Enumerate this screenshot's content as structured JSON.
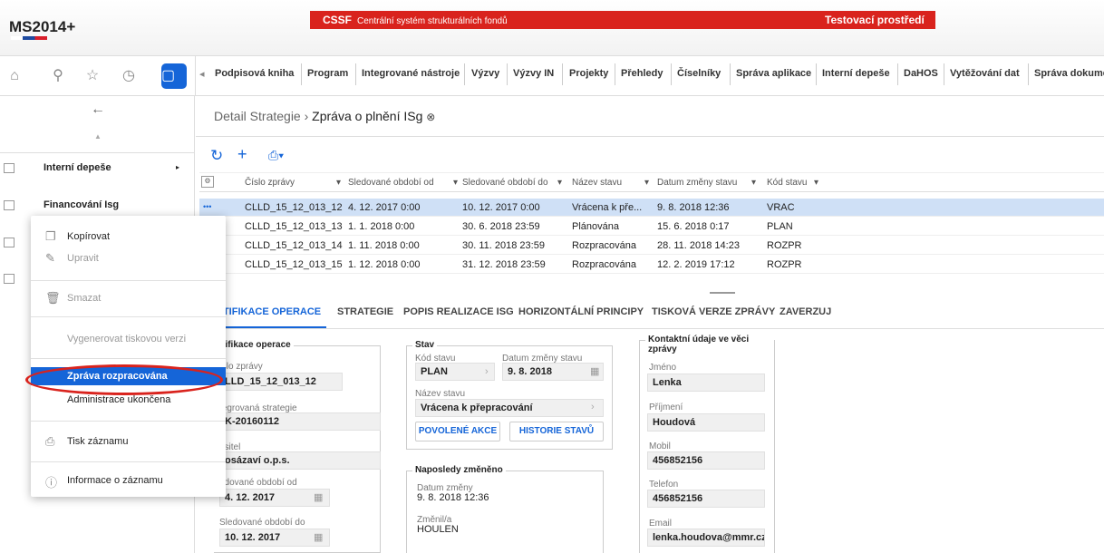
{
  "app": {
    "logo": "MS2014+"
  },
  "banner": {
    "title": "CSSF",
    "subtitle": "Centrální systém strukturálních fondů",
    "env": "Testovací prostředí"
  },
  "menu": [
    "Podpisová kniha",
    "Program",
    "Integrované nástroje",
    "Výzvy",
    "Výzvy IN",
    "Projekty",
    "Přehledy",
    "Číselníky",
    "Správa aplikace",
    "Interní depeše",
    "DaHOS",
    "Vytěžování dat",
    "Správa dokume"
  ],
  "sidebar": {
    "items": [
      {
        "label": "Interní depeše"
      },
      {
        "label": "Financování Isg"
      }
    ]
  },
  "breadcrumb": {
    "parent": "Detail Strategie",
    "current": "Zpráva o plnění ISg"
  },
  "grid": {
    "headers": [
      "Číslo zprávy",
      "Sledované období od",
      "Sledované období do",
      "Název stavu",
      "Datum změny stavu",
      "Kód stavu"
    ],
    "rows": [
      [
        "CLLD_15_12_013_12",
        "4. 12. 2017 0:00",
        "10. 12. 2017 0:00",
        "Vrácena k pře...",
        "9. 8. 2018 12:36",
        "VRAC"
      ],
      [
        "CLLD_15_12_013_13",
        "1. 1. 2018 0:00",
        "30. 6. 2018 23:59",
        "Plánována",
        "15. 6. 2018 0:17",
        "PLAN"
      ],
      [
        "CLLD_15_12_013_14",
        "1. 11. 2018 0:00",
        "30. 11. 2018 23:59",
        "Rozpracována",
        "28. 11. 2018 14:23",
        "ROZPR"
      ],
      [
        "CLLD_15_12_013_15",
        "1. 12. 2018 0:00",
        "31. 12. 2018 23:59",
        "Rozpracována",
        "12. 2. 2019 17:12",
        "ROZPR"
      ]
    ]
  },
  "tabs": [
    "NTIFIKACE OPERACE",
    "STRATEGIE",
    "POPIS REALIZACE ISG",
    "HORIZONTÁLNÍ PRINCIPY",
    "TISKOVÁ VERZE ZPRÁVY",
    "ZAVERZUJ"
  ],
  "ident": {
    "legend": "ntifikace operace",
    "cislo_lbl": "íslo zprávy",
    "cislo": "LLD_15_12_013_12",
    "strat_lbl": "tegrovaná strategie",
    "strat": "K-20160112",
    "nos_lbl": "ositel",
    "nos": "osázaví o.p.s.",
    "od_lbl": "edované období od",
    "od": "4. 12. 2017",
    "do_lbl": "Sledované období do",
    "do": "10. 12. 2017"
  },
  "stav": {
    "legend": "Stav",
    "kod_lbl": "Kód stavu",
    "kod": "PLAN",
    "datum_lbl": "Datum změny stavu",
    "datum": "9. 8. 2018",
    "nazev_lbl": "Název stavu",
    "nazev": "Vrácena k přepracování",
    "btn1": "POVOLENÉ AKCE",
    "btn2": "HISTORIE STAVŮ"
  },
  "posledni": {
    "legend": "Naposledy změněno",
    "dz_lbl": "Datum změny",
    "dz": "9. 8. 2018 12:36",
    "zm_lbl": "Změnil/a",
    "zm": "HOULEN"
  },
  "kontakt": {
    "legend": "Kontaktní údaje ve věci zprávy",
    "jmeno_lbl": "Jméno",
    "jmeno": "Lenka",
    "prijmeni_lbl": "Příjmení",
    "prijmeni": "Houdová",
    "mobil_lbl": "Mobil",
    "mobil": "456852156",
    "tel_lbl": "Telefon",
    "tel": "456852156",
    "email_lbl": "Email",
    "email": "lenka.houdova@mmr.cz"
  },
  "context": {
    "copy": "Kopírovat",
    "edit": "Upravit",
    "del": "Smazat",
    "print_ver": "Vygenerovat tiskovou verzi",
    "opt1": "Zpráva rozpracována",
    "opt2": "Administrace ukončena",
    "print": "Tisk záznamu",
    "info": "Informace o záznamu"
  }
}
